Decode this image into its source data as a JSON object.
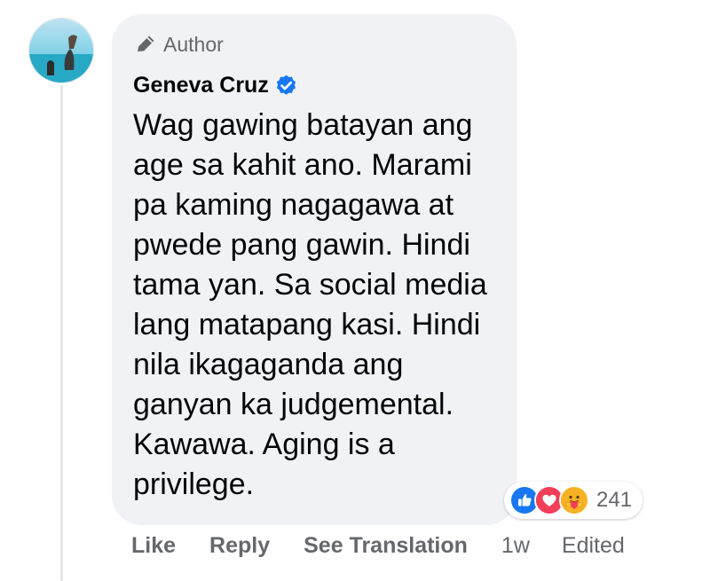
{
  "comment": {
    "badge": {
      "icon": "pencil-icon",
      "label": "Author"
    },
    "author_name": "Geneva Cruz",
    "verified_icon": "verified-check-icon",
    "text_lines": [
      "Wag gawing batayan ang",
      "age sa kahit ano. Marami",
      "pa kaming nagagawa at",
      "pwede pang gawin. Hindi",
      "tama yan. Sa social media",
      "lang matapang kasi. Hindi",
      "nila ikagaganda ang",
      "ganyan ka judgemental.",
      "Kawawa. Aging is a",
      "privilege."
    ],
    "reactions": {
      "icons": [
        "like-reaction-icon",
        "love-reaction-icon",
        "care-reaction-icon"
      ],
      "count": "241"
    },
    "actions": {
      "like": "Like",
      "reply": "Reply",
      "see_translation": "See Translation",
      "time": "1w",
      "edited": "Edited"
    }
  },
  "colors": {
    "bubble_bg": "#f0f2f5",
    "secondary_text": "#65676b",
    "primary_text": "#050505",
    "brand_blue": "#1877f2",
    "love_red": "#f33e58",
    "care_yellow": "#f7b125"
  }
}
